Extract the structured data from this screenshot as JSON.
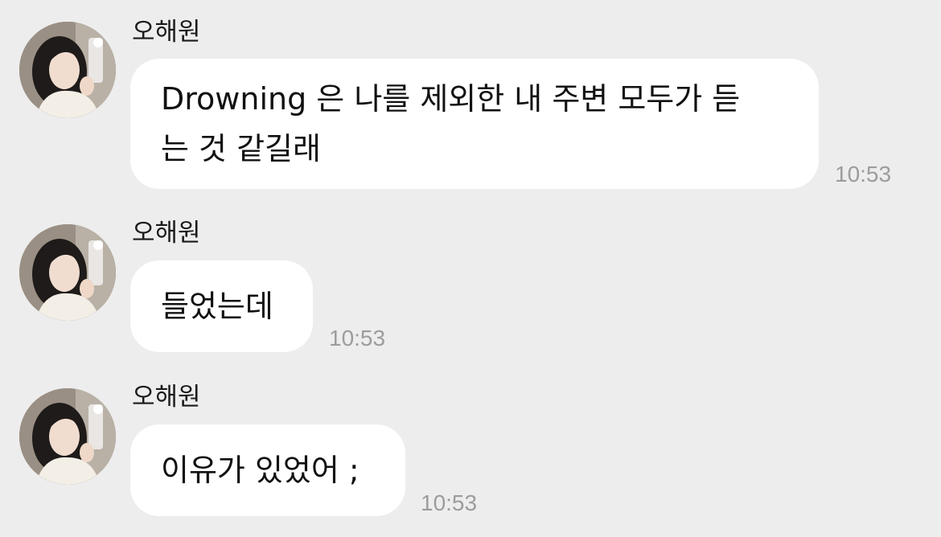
{
  "conversation": {
    "messages": [
      {
        "sender": "오해원",
        "text": "Drowning 은 나를 제외한 내 주변 모두가 듣\n는 것 같길래",
        "time": "10:53"
      },
      {
        "sender": "오해원",
        "text": "들었는데",
        "time": "10:53"
      },
      {
        "sender": "오해원",
        "text": "이유가 있었어 ;",
        "time": "10:53"
      }
    ]
  },
  "colors": {
    "background": "#ededed",
    "bubble": "#ffffff",
    "timestamp": "#9c9c9c"
  },
  "icons": {
    "avatar": "profile-photo"
  }
}
